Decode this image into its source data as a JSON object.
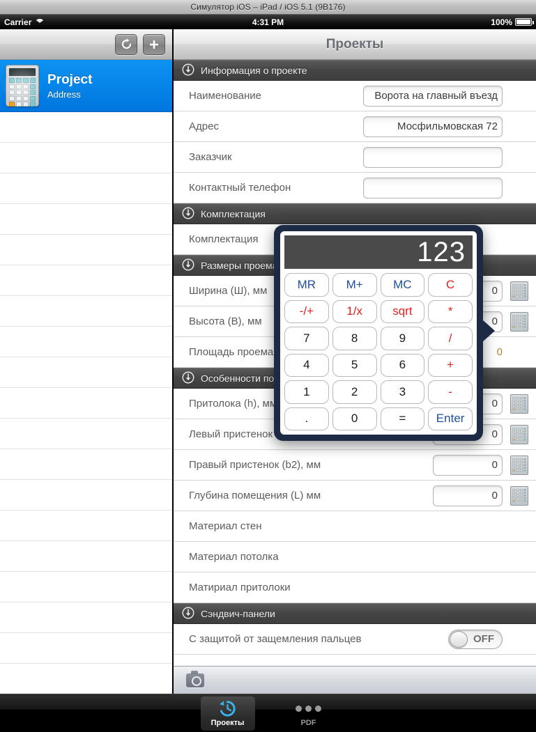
{
  "simulator": {
    "window_title": "Симулятор iOS – iPad / iOS 5.1 (9B176)"
  },
  "status_bar": {
    "carrier": "Carrier",
    "wifi_icon": "wifi-icon",
    "time": "4:31 PM",
    "battery_percent": "100%",
    "battery_icon": "battery-icon"
  },
  "sidebar": {
    "toolbar": {
      "refresh_label": "↻",
      "add_label": "+"
    },
    "items": [
      {
        "title": "Project",
        "subtitle": "Address",
        "icon": "calculator-icon",
        "selected": true
      }
    ]
  },
  "detail": {
    "nav_title": "Проекты",
    "sections": [
      {
        "header": "Информация о проекте",
        "icon": "arrow-down-circle-icon",
        "rows": [
          {
            "label": "Наименование",
            "value": "Ворота на главный въезд",
            "field": true
          },
          {
            "label": "Адрес",
            "value": "Мосфильмовская 72",
            "field": true
          },
          {
            "label": "Заказчик",
            "value": "",
            "field": true
          },
          {
            "label": "Контактный телефон",
            "value": "",
            "field": true
          }
        ]
      },
      {
        "header": "Комплектация",
        "icon": "arrow-down-circle-icon",
        "rows": [
          {
            "label": "Комплектация",
            "value": "",
            "field": false
          }
        ]
      },
      {
        "header": "Размеры проема",
        "icon": "arrow-down-circle-icon",
        "rows": [
          {
            "label": "Ширина (Ш), мм",
            "value": "0",
            "field": true,
            "calc": true
          },
          {
            "label": "Высота (В), мм",
            "value": "0",
            "field": true,
            "calc": true
          },
          {
            "label": "Площадь проема",
            "value": "0",
            "field": false
          }
        ]
      },
      {
        "header": "Особенности помещения",
        "icon": "arrow-down-circle-icon",
        "rows": [
          {
            "label": "Притолока (h), мм",
            "value": "0",
            "field": true,
            "calc": true
          },
          {
            "label": "Левый пристенок (b1), мм",
            "value": "0",
            "field": true,
            "calc": true
          },
          {
            "label": "Правый пристенок (b2), мм",
            "value": "0",
            "field": true,
            "calc": true
          },
          {
            "label": "Глубина помещения (L) мм",
            "value": "0",
            "field": true,
            "calc": true
          },
          {
            "label": "Материал стен",
            "value": "",
            "field": false
          },
          {
            "label": "Материал потолка",
            "value": "",
            "field": false
          },
          {
            "label": "Матириал притолоки",
            "value": "",
            "field": false
          }
        ]
      },
      {
        "header": "Сэндвич-панели",
        "icon": "arrow-down-circle-icon",
        "rows": [
          {
            "label": "С защитой от защемления пальцев",
            "value": "OFF",
            "field": false,
            "toggle": true
          }
        ]
      }
    ],
    "toolbar": {
      "camera_icon": "camera-icon"
    }
  },
  "calculator": {
    "display": "123",
    "keys": [
      {
        "label": "MR",
        "style": "blue"
      },
      {
        "label": "M+",
        "style": "blue"
      },
      {
        "label": "MC",
        "style": "blue"
      },
      {
        "label": "C",
        "style": "red"
      },
      {
        "label": "-/+",
        "style": "red"
      },
      {
        "label": "1/x",
        "style": "red"
      },
      {
        "label": "sqrt",
        "style": "red"
      },
      {
        "label": "*",
        "style": "red"
      },
      {
        "label": "7",
        "style": "black"
      },
      {
        "label": "8",
        "style": "black"
      },
      {
        "label": "9",
        "style": "black"
      },
      {
        "label": "/",
        "style": "red"
      },
      {
        "label": "4",
        "style": "black"
      },
      {
        "label": "5",
        "style": "black"
      },
      {
        "label": "6",
        "style": "black"
      },
      {
        "label": "+",
        "style": "red"
      },
      {
        "label": "1",
        "style": "black"
      },
      {
        "label": "2",
        "style": "black"
      },
      {
        "label": "3",
        "style": "black"
      },
      {
        "label": "-",
        "style": "red"
      },
      {
        "label": ".",
        "style": "black"
      },
      {
        "label": "0",
        "style": "black"
      },
      {
        "label": "=",
        "style": "black"
      },
      {
        "label": "Enter",
        "style": "blue"
      }
    ]
  },
  "tab_bar": {
    "tabs": [
      {
        "label": "Проекты",
        "icon": "history-clock-icon",
        "selected": true
      },
      {
        "label": "PDF",
        "icon": "more-dots-icon",
        "selected": false
      }
    ]
  },
  "colors": {
    "accent_blue": "#0d93f2",
    "popover_border": "#1c2a45",
    "key_red": "#e02020",
    "key_blue": "#1f4f9b",
    "section_header": "#454545"
  }
}
